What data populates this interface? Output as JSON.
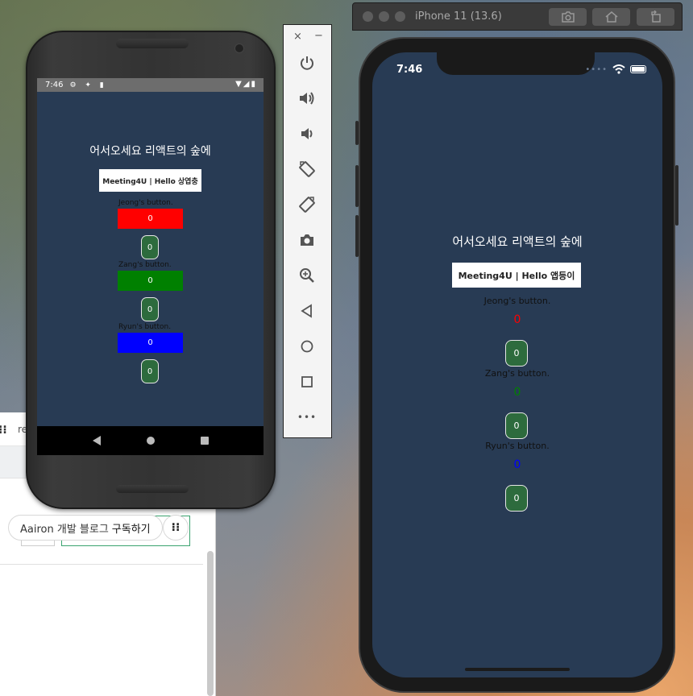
{
  "background_browser": {
    "top_text": "re",
    "subscribe_prefix": "Aairon 개발 블로그",
    "subscribe_action": "구독하기",
    "menu_icon": "more-dots-icon"
  },
  "android": {
    "status": {
      "time": "7:46"
    },
    "app": {
      "title": "어서오세요 리액트의 숲에",
      "input_value": "Meeting4U | Hello 상엽충",
      "buttons": [
        {
          "label": "Jeong's button.",
          "count": "0",
          "color": "#ff0000"
        },
        {
          "label": "Zang's button.",
          "count": "0",
          "color": "#008000"
        },
        {
          "label": "Ryun's button.",
          "count": "0",
          "color": "#0000ff"
        }
      ]
    }
  },
  "emulator_toolbar": {
    "close": "×",
    "minimize": "−",
    "more": "•••",
    "icons": [
      "power-icon",
      "volume-up-icon",
      "volume-down-icon",
      "rotate-left-icon",
      "rotate-right-icon",
      "camera-icon",
      "zoom-icon",
      "back-icon",
      "home-icon",
      "overview-icon",
      "more-icon"
    ]
  },
  "ios": {
    "window_title": "iPhone 11 (13.6)",
    "status": {
      "time": "7:46"
    },
    "app": {
      "title": "어서오세요 리액트의 숲에",
      "input_value": "Meeting4U | Hello 앱등이",
      "buttons": [
        {
          "label": "Jeong's button.",
          "count": "0",
          "color": "#ff0000"
        },
        {
          "label": "Zang's button.",
          "count": "0",
          "color": "#008000"
        },
        {
          "label": "Ryun's button.",
          "count": "0",
          "color": "#0000ff"
        }
      ]
    }
  }
}
